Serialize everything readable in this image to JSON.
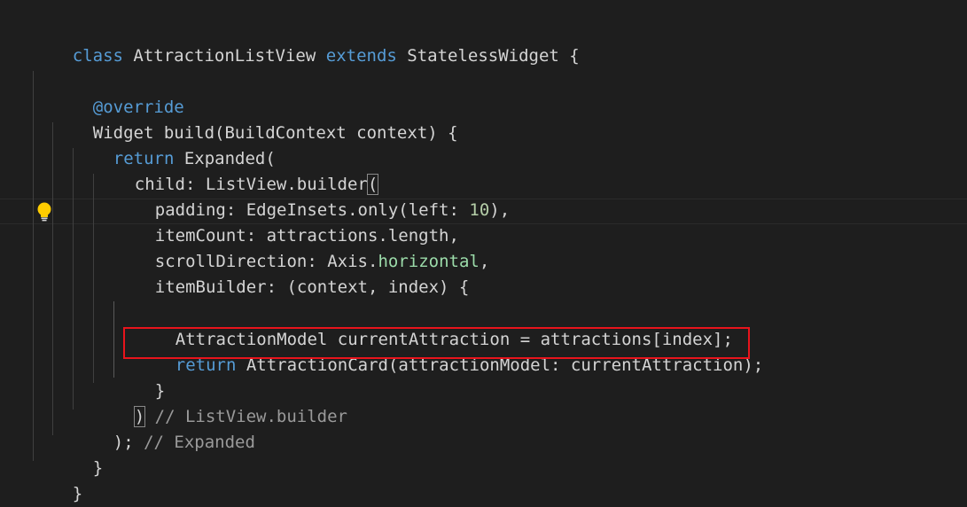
{
  "code": {
    "l1_kw": "class",
    "l1_name": " AttractionListView ",
    "l1_kw2": "extends",
    "l1_rest": " StatelessWidget {",
    "l3": "@override",
    "l4": "Widget build(BuildContext context) {",
    "l5_kw": "return",
    "l5_rest": " Expanded(",
    "l6_pre": "child: ListView.builder",
    "l6_paren": "(",
    "l7_pre": "padding: EdgeInsets.only(left: ",
    "l7_num": "10",
    "l7_post": "),",
    "l8": "itemCount: attractions.length,",
    "l9_pre": "scrollDirection: Axis.",
    "l9_val": "horizontal",
    "l9_post": ",",
    "l10": "itemBuilder: (context, index) {",
    "l12": "AttractionModel currentAttraction = attractions[index];",
    "l13_kw": "return",
    "l13_rest": " AttractionCard(attractionModel: currentAttraction);",
    "l14": "}",
    "l15_paren": ")",
    "l15_comment": " // ListView.builder",
    "l16_pre": ");",
    "l16_comment": " // Expanded",
    "l17": "}",
    "l18": "}"
  },
  "icons": {
    "lightbulb": "lightbulb-icon"
  },
  "colors": {
    "background": "#1e1e1e",
    "keyword": "#569cd6",
    "type": "#4ec9b0",
    "comment": "#6a9955",
    "number": "#b5cea8",
    "highlight_box": "#e8141c",
    "lightbulb": "#ffcc00"
  }
}
